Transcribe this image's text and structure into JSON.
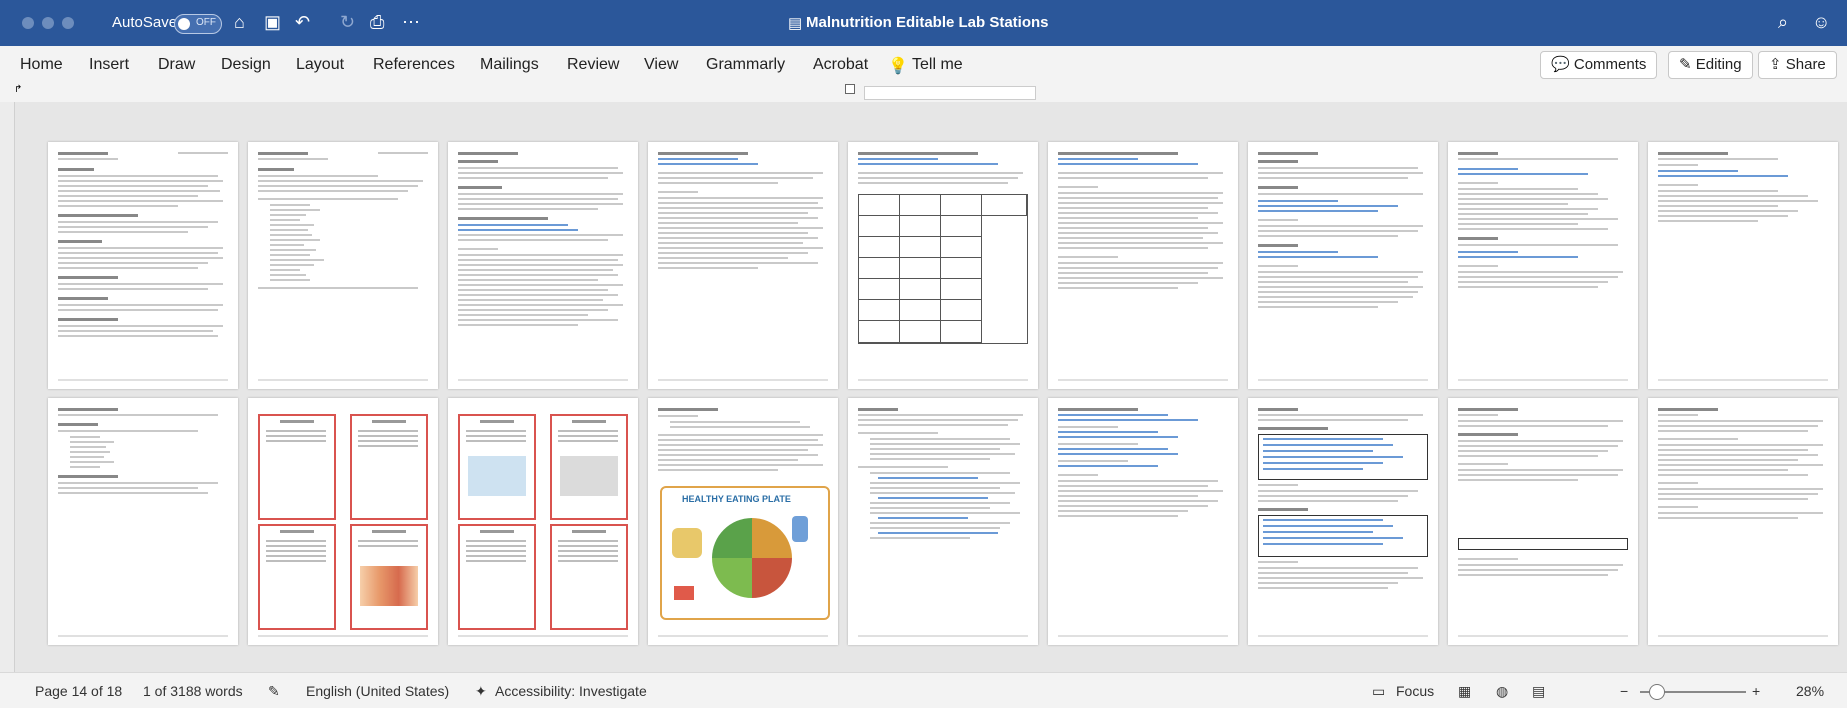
{
  "titlebar": {
    "autosave_label": "AutoSave",
    "autosave_state": "OFF",
    "document_title": "Malnutrition Editable Lab Stations",
    "icons": [
      "home-icon",
      "save-icon",
      "undo-icon",
      "redo-icon",
      "print-icon",
      "more-icon",
      "search-icon",
      "share-profile-icon"
    ]
  },
  "ribbon": {
    "tabs": [
      "Home",
      "Insert",
      "Draw",
      "Design",
      "Layout",
      "References",
      "Mailings",
      "Review",
      "View",
      "Grammarly",
      "Acrobat",
      "Tell me"
    ],
    "comments_label": "Comments",
    "editing_label": "Editing",
    "share_label": "Share"
  },
  "plate": {
    "title": "HEALTHY EATING PLATE"
  },
  "status": {
    "page": "Page 14 of 18",
    "words": "1 of 3188 words",
    "language": "English (United States)",
    "accessibility": "Accessibility: Investigate",
    "focus": "Focus",
    "zoom": "28%"
  },
  "colors": {
    "titlebar": "#2b579a",
    "accent": "#d9534f",
    "link": "#6b9ad6"
  }
}
